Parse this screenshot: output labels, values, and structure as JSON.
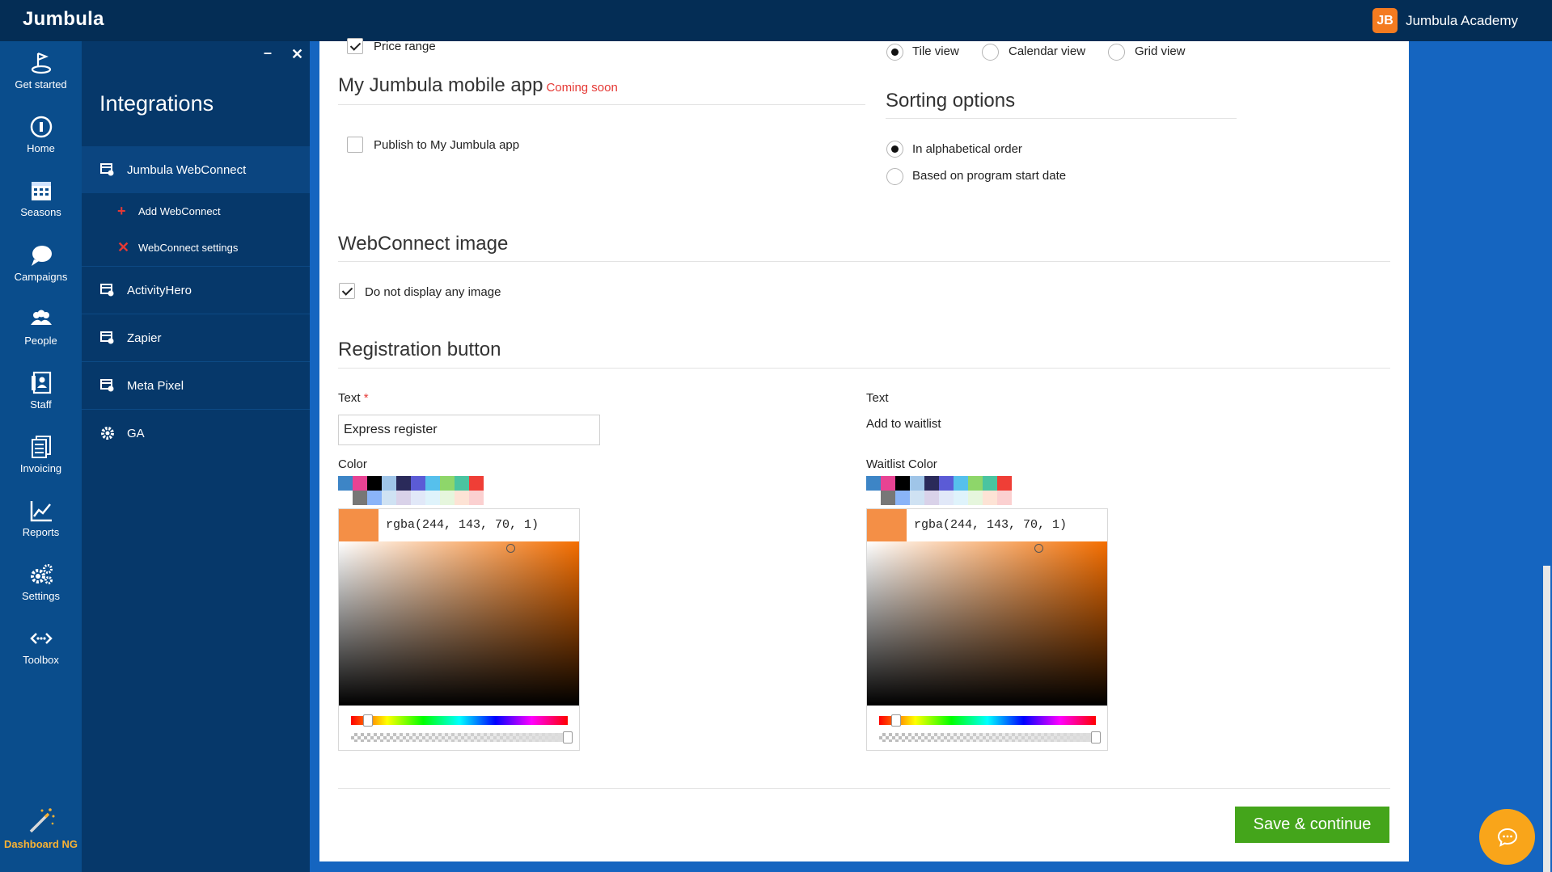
{
  "app": {
    "brand": "Jumbula",
    "academy_label": "Jumbula Academy",
    "academy_logo": "JB"
  },
  "leftnav": {
    "items": [
      {
        "label": "Get started",
        "icon": "get-started-icon"
      },
      {
        "label": "Home",
        "icon": "home-icon"
      },
      {
        "label": "Seasons",
        "icon": "calendar-icon"
      },
      {
        "label": "Campaigns",
        "icon": "chat-bubble-icon"
      },
      {
        "label": "People",
        "icon": "people-icon"
      },
      {
        "label": "Staff",
        "icon": "staff-icon"
      },
      {
        "label": "Invoicing",
        "icon": "invoice-icon"
      },
      {
        "label": "Reports",
        "icon": "chart-icon"
      },
      {
        "label": "Settings",
        "icon": "gears-icon"
      },
      {
        "label": "Toolbox",
        "icon": "toolbox-icon"
      }
    ],
    "dashboard": {
      "label": "Dashboard NG",
      "icon": "magic-wand-icon"
    }
  },
  "panel": {
    "minimize": "–",
    "close": "✕",
    "title": "Integrations",
    "items": [
      {
        "label": "Jumbula WebConnect",
        "icon": "integration-icon"
      },
      {
        "label": "ActivityHero",
        "icon": "integration-icon"
      },
      {
        "label": "Zapier",
        "icon": "integration-icon"
      },
      {
        "label": "Meta Pixel",
        "icon": "integration-icon"
      },
      {
        "label": "GA",
        "icon": "gear-icon"
      }
    ],
    "subitems": [
      {
        "label": "Add WebConnect",
        "icon": "plus-icon"
      },
      {
        "label": "WebConnect settings",
        "icon": "tools-icon"
      }
    ]
  },
  "form": {
    "price_range": {
      "label": "Price range",
      "checked": true
    },
    "views": [
      {
        "label": "Tile view",
        "selected": true
      },
      {
        "label": "Calendar view",
        "selected": false
      },
      {
        "label": "Grid view",
        "selected": false
      }
    ],
    "mobile_app": {
      "title": "My Jumbula mobile app",
      "badge": "Coming soon",
      "publish_label": "Publish to My Jumbula app",
      "publish_checked": false
    },
    "sorting": {
      "title": "Sorting options",
      "options": [
        {
          "label": "In alphabetical order",
          "selected": true
        },
        {
          "label": "Based on program start date",
          "selected": false
        }
      ]
    },
    "image": {
      "title": "WebConnect image",
      "no_image_label": "Do not display any image",
      "no_image_checked": true
    },
    "registration": {
      "title": "Registration button",
      "text_label": "Text",
      "required_mark": "*",
      "text_value": "Express register",
      "color_label": "Color",
      "color_value": "rgba(244, 143, 70, 1)",
      "waitlist_text_label": "Text",
      "waitlist_text_value": "Add to waitlist",
      "waitlist_color_label": "Waitlist Color",
      "waitlist_color_value": "rgba(244, 143, 70, 1)",
      "current_color": "#f48f46",
      "swatches": [
        "#3d85c6",
        "#e84393",
        "#000000",
        "#9fc5e8",
        "#2a2a5a",
        "#5b5bd6",
        "#56c0ec",
        "#8ed66a",
        "#4ac4a0",
        "#ef3e36",
        "#ffffff",
        "#777777",
        "#8ab4f8",
        "#cfe2f3",
        "#d9d2e9",
        "#e1e8f8",
        "#dff3fb",
        "#e6f6dd",
        "#fde3d5",
        "#fbd0d0"
      ]
    },
    "save_label": "Save & continue"
  },
  "chat": {
    "icon": "chat-icon"
  }
}
